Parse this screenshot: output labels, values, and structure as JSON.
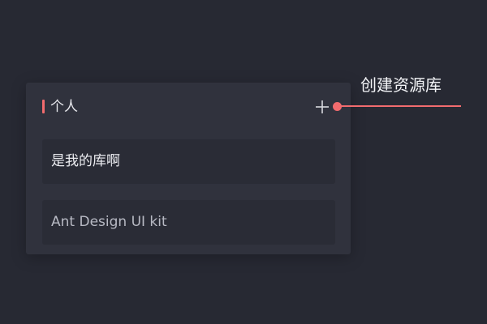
{
  "panel": {
    "title": "个人",
    "add_icon": "plus-icon",
    "items": [
      {
        "label": "是我的库啊"
      },
      {
        "label": "Ant Design UI kit"
      }
    ]
  },
  "annotation": {
    "label": "创建资源库"
  },
  "colors": {
    "background": "#272933",
    "panel": "#30323d",
    "item": "#2a2c36",
    "accent": "#f26b6e",
    "text": "#e6e7ec"
  }
}
